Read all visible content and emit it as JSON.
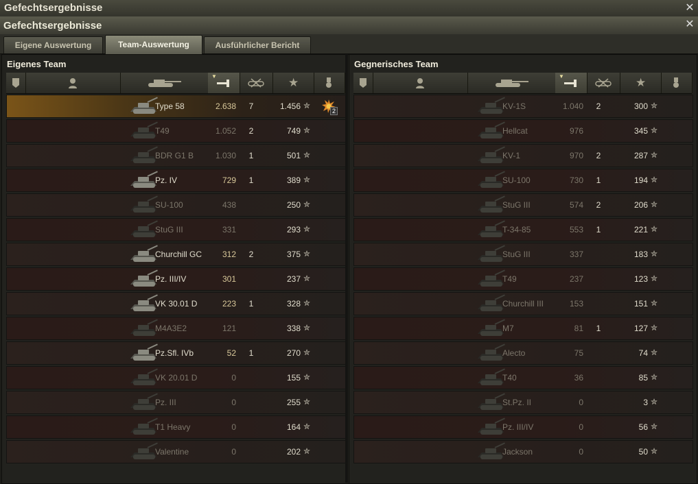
{
  "window": {
    "outer_title": "Gefechtsergebnisse",
    "inner_title": "Gefechtsergebnisse"
  },
  "tabs": [
    {
      "label": "Eigene Auswertung",
      "active": false
    },
    {
      "label": "Team-Auswertung",
      "active": true
    },
    {
      "label": "Ausführlicher Bericht",
      "active": false
    }
  ],
  "own_team": {
    "title": "Eigenes Team",
    "rows": [
      {
        "name": "Type 58",
        "damage": "2.638",
        "kills": "7",
        "xp": "1.456",
        "self": true,
        "alive": true,
        "medal": "2"
      },
      {
        "name": "T49",
        "damage": "1.052",
        "kills": "2",
        "xp": "749",
        "alive": false
      },
      {
        "name": "BDR G1 B",
        "damage": "1.030",
        "kills": "1",
        "xp": "501",
        "alive": false
      },
      {
        "name": "Pz. IV",
        "damage": "729",
        "kills": "1",
        "xp": "389",
        "alive": true
      },
      {
        "name": "SU-100",
        "damage": "438",
        "kills": "",
        "xp": "250",
        "alive": false
      },
      {
        "name": "StuG III",
        "damage": "331",
        "kills": "",
        "xp": "293",
        "alive": false
      },
      {
        "name": "Churchill GC",
        "damage": "312",
        "kills": "2",
        "xp": "375",
        "alive": true
      },
      {
        "name": "Pz. III/IV",
        "damage": "301",
        "kills": "",
        "xp": "237",
        "alive": true
      },
      {
        "name": "VK 30.01 D",
        "damage": "223",
        "kills": "1",
        "xp": "328",
        "alive": true
      },
      {
        "name": "M4A3E2",
        "damage": "121",
        "kills": "",
        "xp": "338",
        "alive": false
      },
      {
        "name": "Pz.Sfl. IVb",
        "damage": "52",
        "kills": "1",
        "xp": "270",
        "alive": true
      },
      {
        "name": "VK 20.01 D",
        "damage": "0",
        "kills": "",
        "xp": "155",
        "alive": false
      },
      {
        "name": "Pz. III",
        "damage": "0",
        "kills": "",
        "xp": "255",
        "alive": false
      },
      {
        "name": "T1 Heavy",
        "damage": "0",
        "kills": "",
        "xp": "164",
        "alive": false
      },
      {
        "name": "Valentine",
        "damage": "0",
        "kills": "",
        "xp": "202",
        "alive": false
      }
    ]
  },
  "enemy_team": {
    "title": "Gegnerisches Team",
    "rows": [
      {
        "name": "KV-1S",
        "damage": "1.040",
        "kills": "2",
        "xp": "300",
        "alive": false
      },
      {
        "name": "Hellcat",
        "damage": "976",
        "kills": "",
        "xp": "345",
        "alive": false
      },
      {
        "name": "KV-1",
        "damage": "970",
        "kills": "2",
        "xp": "287",
        "alive": false
      },
      {
        "name": "SU-100",
        "damage": "730",
        "kills": "1",
        "xp": "194",
        "alive": false
      },
      {
        "name": "StuG III",
        "damage": "574",
        "kills": "2",
        "xp": "206",
        "alive": false
      },
      {
        "name": "T-34-85",
        "damage": "553",
        "kills": "1",
        "xp": "221",
        "alive": false
      },
      {
        "name": "StuG III",
        "damage": "337",
        "kills": "",
        "xp": "183",
        "alive": false
      },
      {
        "name": "T49",
        "damage": "237",
        "kills": "",
        "xp": "123",
        "alive": false
      },
      {
        "name": "Churchill III",
        "damage": "153",
        "kills": "",
        "xp": "151",
        "alive": false
      },
      {
        "name": "M7",
        "damage": "81",
        "kills": "1",
        "xp": "127",
        "alive": false
      },
      {
        "name": "Alecto",
        "damage": "75",
        "kills": "",
        "xp": "74",
        "alive": false
      },
      {
        "name": "T40",
        "damage": "36",
        "kills": "",
        "xp": "85",
        "alive": false
      },
      {
        "name": "St.Pz. II",
        "damage": "0",
        "kills": "",
        "xp": "3",
        "alive": false
      },
      {
        "name": "Pz. III/IV",
        "damage": "0",
        "kills": "",
        "xp": "56",
        "alive": false
      },
      {
        "name": "Jackson",
        "damage": "0",
        "kills": "",
        "xp": "50",
        "alive": false
      }
    ]
  },
  "columns": [
    {
      "icon": "squad-icon"
    },
    {
      "icon": "player-icon"
    },
    {
      "icon": "tank-icon"
    },
    {
      "icon": "damage-icon",
      "sorted": true
    },
    {
      "icon": "kills-icon"
    },
    {
      "icon": "xp-star-icon"
    },
    {
      "icon": "medal-icon"
    }
  ],
  "colors": {
    "self_highlight": "#7a5418",
    "row_bg": "#2a1c19",
    "text_alive": "#e0dccc",
    "text_dead": "#7c766a",
    "damage_alive": "#d8c89a"
  }
}
